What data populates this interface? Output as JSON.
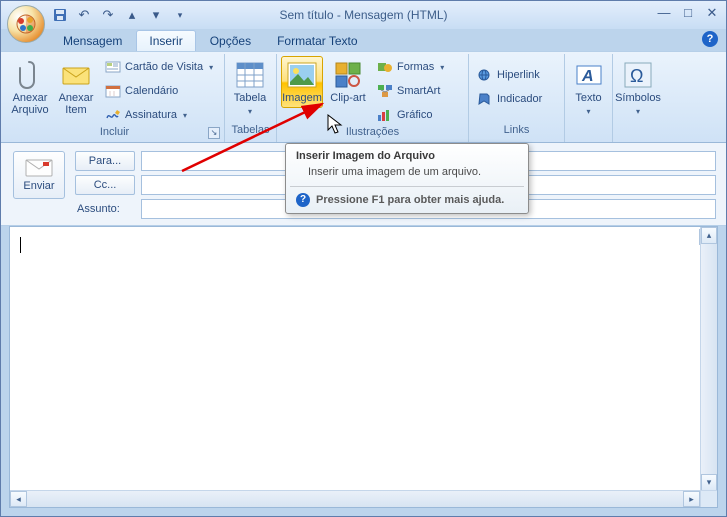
{
  "window": {
    "title": "Sem título - Mensagem (HTML)"
  },
  "qat": {
    "save": "save",
    "undo": "undo",
    "redo": "redo",
    "prev": "prev",
    "next": "next"
  },
  "tabs": {
    "message": "Mensagem",
    "insert": "Inserir",
    "options": "Opções",
    "format": "Formatar Texto"
  },
  "ribbon": {
    "include": {
      "attach_file": "Anexar\nArquivo",
      "attach_item": "Anexar\nItem",
      "business_card": "Cartão de Visita",
      "calendar": "Calendário",
      "signature": "Assinatura",
      "group": "Incluir"
    },
    "tables": {
      "table": "Tabela",
      "group": "Tabelas"
    },
    "illustrations": {
      "picture": "Imagem",
      "clipart": "Clip-art",
      "shapes": "Formas",
      "smartart": "SmartArt",
      "chart": "Gráfico",
      "group": "Ilustrações"
    },
    "links": {
      "hyperlink": "Hiperlink",
      "bookmark": "Indicador",
      "group": "Links"
    },
    "text": {
      "textbox": "Texto",
      "group": ""
    },
    "symbols": {
      "symbol": "Símbolos",
      "group": ""
    }
  },
  "header": {
    "send": "Enviar",
    "to": "Para...",
    "cc": "Cc...",
    "subject": "Assunto:"
  },
  "tooltip": {
    "title": "Inserir Imagem do Arquivo",
    "body": "Inserir uma imagem de um arquivo.",
    "help": "Pressione F1 para obter mais ajuda."
  }
}
